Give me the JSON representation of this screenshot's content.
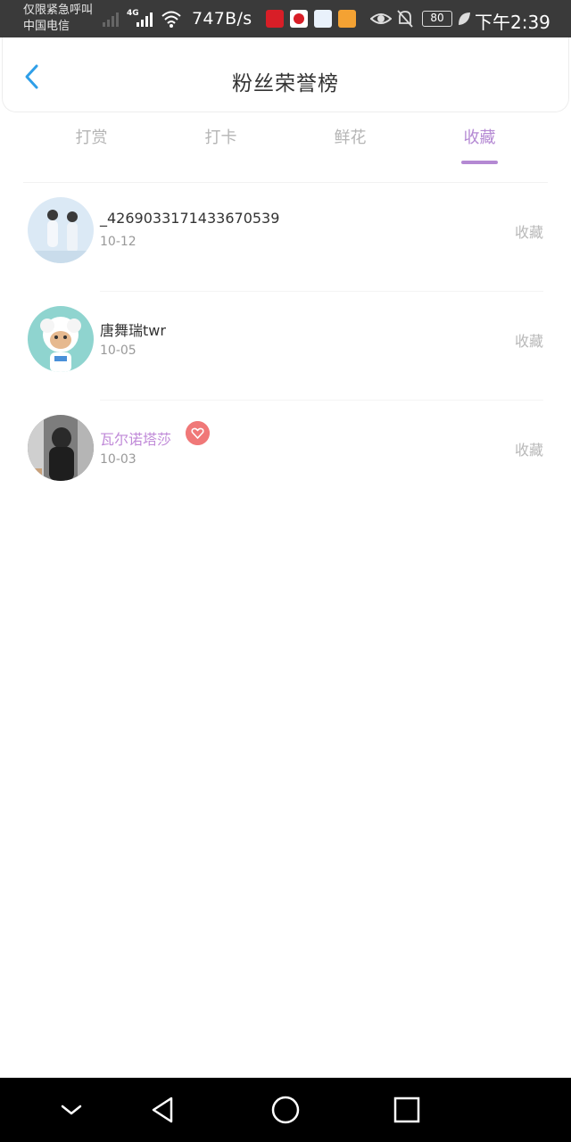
{
  "status_bar": {
    "carrier_line1": "仅限紧急呼叫",
    "carrier_line2": "中国电信",
    "network_type": "4G",
    "speed": "747B/s",
    "battery": "80",
    "time": "下午2:39",
    "icons": [
      "signal-icon",
      "wifi-icon",
      "app-notification-icon",
      "eye-icon",
      "bell-off-icon",
      "battery-icon",
      "leaf-icon"
    ]
  },
  "header": {
    "title": "粉丝荣誉榜",
    "back_icon": "chevron-left-icon"
  },
  "tabs": {
    "items": [
      {
        "label": "打赏"
      },
      {
        "label": "打卡"
      },
      {
        "label": "鲜花"
      },
      {
        "label": "收藏"
      }
    ],
    "active_index": 3,
    "active_color": "#b489d3"
  },
  "fans": [
    {
      "name": "_4269033171433670539",
      "date": "10-12",
      "action": "收藏",
      "vip": false
    },
    {
      "name": "唐舞瑞twr",
      "date": "10-05",
      "action": "收藏",
      "vip": false
    },
    {
      "name": "瓦尔诺塔莎",
      "date": "10-03",
      "action": "收藏",
      "vip": true
    }
  ],
  "nav_bar": {
    "icons": [
      "chevron-down-icon",
      "back-triangle-icon",
      "home-circle-icon",
      "recents-square-icon"
    ]
  }
}
